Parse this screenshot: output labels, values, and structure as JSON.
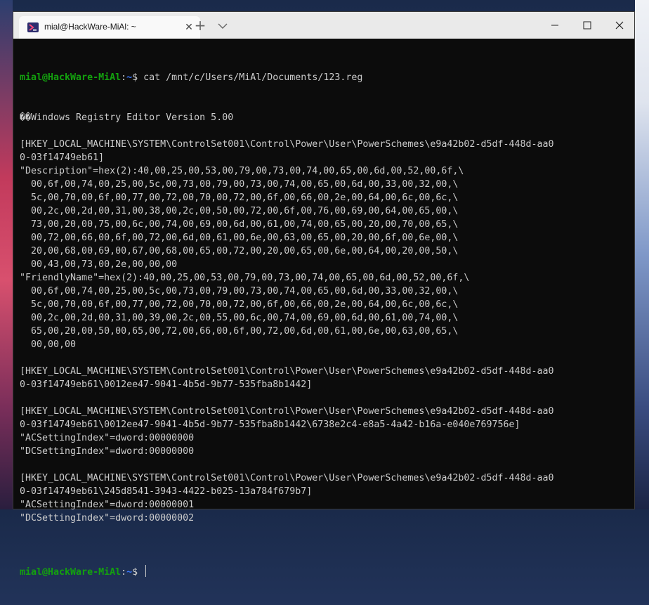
{
  "window": {
    "tab_title": "mial@HackWare-MiAl: ~",
    "tab_close_glyph": "✕",
    "new_tab_glyph": "+"
  },
  "prompt": {
    "user": "mial@HackWare-MiAl",
    "sep": ":",
    "path": "~",
    "symbol": "$ "
  },
  "command": "cat /mnt/c/Users/MiAl/Documents/123.reg",
  "output": [
    "��Windows Registry Editor Version 5.00",
    "",
    "[HKEY_LOCAL_MACHINE\\SYSTEM\\ControlSet001\\Control\\Power\\User\\PowerSchemes\\e9a42b02-d5df-448d-aa0",
    "0-03f14749eb61]",
    "\"Description\"=hex(2):40,00,25,00,53,00,79,00,73,00,74,00,65,00,6d,00,52,00,6f,\\",
    "  00,6f,00,74,00,25,00,5c,00,73,00,79,00,73,00,74,00,65,00,6d,00,33,00,32,00,\\",
    "  5c,00,70,00,6f,00,77,00,72,00,70,00,72,00,6f,00,66,00,2e,00,64,00,6c,00,6c,\\",
    "  00,2c,00,2d,00,31,00,38,00,2c,00,50,00,72,00,6f,00,76,00,69,00,64,00,65,00,\\",
    "  73,00,20,00,75,00,6c,00,74,00,69,00,6d,00,61,00,74,00,65,00,20,00,70,00,65,\\",
    "  00,72,00,66,00,6f,00,72,00,6d,00,61,00,6e,00,63,00,65,00,20,00,6f,00,6e,00,\\",
    "  20,00,68,00,69,00,67,00,68,00,65,00,72,00,20,00,65,00,6e,00,64,00,20,00,50,\\",
    "  00,43,00,73,00,2e,00,00,00",
    "\"FriendlyName\"=hex(2):40,00,25,00,53,00,79,00,73,00,74,00,65,00,6d,00,52,00,6f,\\",
    "  00,6f,00,74,00,25,00,5c,00,73,00,79,00,73,00,74,00,65,00,6d,00,33,00,32,00,\\",
    "  5c,00,70,00,6f,00,77,00,72,00,70,00,72,00,6f,00,66,00,2e,00,64,00,6c,00,6c,\\",
    "  00,2c,00,2d,00,31,00,39,00,2c,00,55,00,6c,00,74,00,69,00,6d,00,61,00,74,00,\\",
    "  65,00,20,00,50,00,65,00,72,00,66,00,6f,00,72,00,6d,00,61,00,6e,00,63,00,65,\\",
    "  00,00,00",
    "",
    "[HKEY_LOCAL_MACHINE\\SYSTEM\\ControlSet001\\Control\\Power\\User\\PowerSchemes\\e9a42b02-d5df-448d-aa0",
    "0-03f14749eb61\\0012ee47-9041-4b5d-9b77-535fba8b1442]",
    "",
    "[HKEY_LOCAL_MACHINE\\SYSTEM\\ControlSet001\\Control\\Power\\User\\PowerSchemes\\e9a42b02-d5df-448d-aa0",
    "0-03f14749eb61\\0012ee47-9041-4b5d-9b77-535fba8b1442\\6738e2c4-e8a5-4a42-b16a-e040e769756e]",
    "\"ACSettingIndex\"=dword:00000000",
    "\"DCSettingIndex\"=dword:00000000",
    "",
    "[HKEY_LOCAL_MACHINE\\SYSTEM\\ControlSet001\\Control\\Power\\User\\PowerSchemes\\e9a42b02-d5df-448d-aa0",
    "0-03f14749eb61\\245d8541-3943-4422-b025-13a784f679b7]",
    "\"ACSettingIndex\"=dword:00000001",
    "\"DCSettingIndex\"=dword:00000002",
    ""
  ],
  "colors": {
    "terminal_bg": "#0c0c0c",
    "text": "#cccccc",
    "prompt_user": "#13a10e",
    "prompt_path": "#3b78ff",
    "titlebar": "#eaeaea"
  },
  "icons": {
    "tab": "terminal-app-icon",
    "dropdown": "chevron-down-icon",
    "minimize": "minimize-icon",
    "maximize": "maximize-icon",
    "close": "close-icon"
  }
}
